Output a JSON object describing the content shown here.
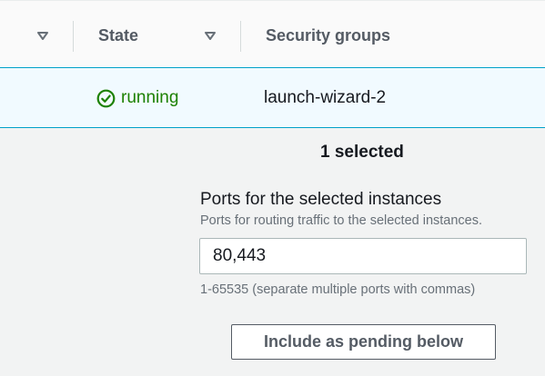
{
  "table": {
    "columns": [
      {
        "label": "",
        "sortable": true
      },
      {
        "label": "State",
        "sortable": true
      },
      {
        "label": "Security groups",
        "sortable": false
      }
    ],
    "rows": [
      {
        "selected": true,
        "state": {
          "label": "running",
          "icon": "check-circle-icon",
          "color": "#1d8102"
        },
        "security_group": "launch-wizard-2"
      }
    ]
  },
  "selection": {
    "count_label": "1 selected"
  },
  "ports_field": {
    "label": "Ports for the selected instances",
    "description": "Ports for routing traffic to the selected instances.",
    "value": "80,443",
    "constraint": "1-65535 (separate multiple ports with commas)"
  },
  "actions": {
    "include_pending_label": "Include as pending below"
  },
  "colors": {
    "accent_border": "#00a1c9",
    "selected_row_bg": "#f1faff",
    "success": "#1d8102"
  }
}
